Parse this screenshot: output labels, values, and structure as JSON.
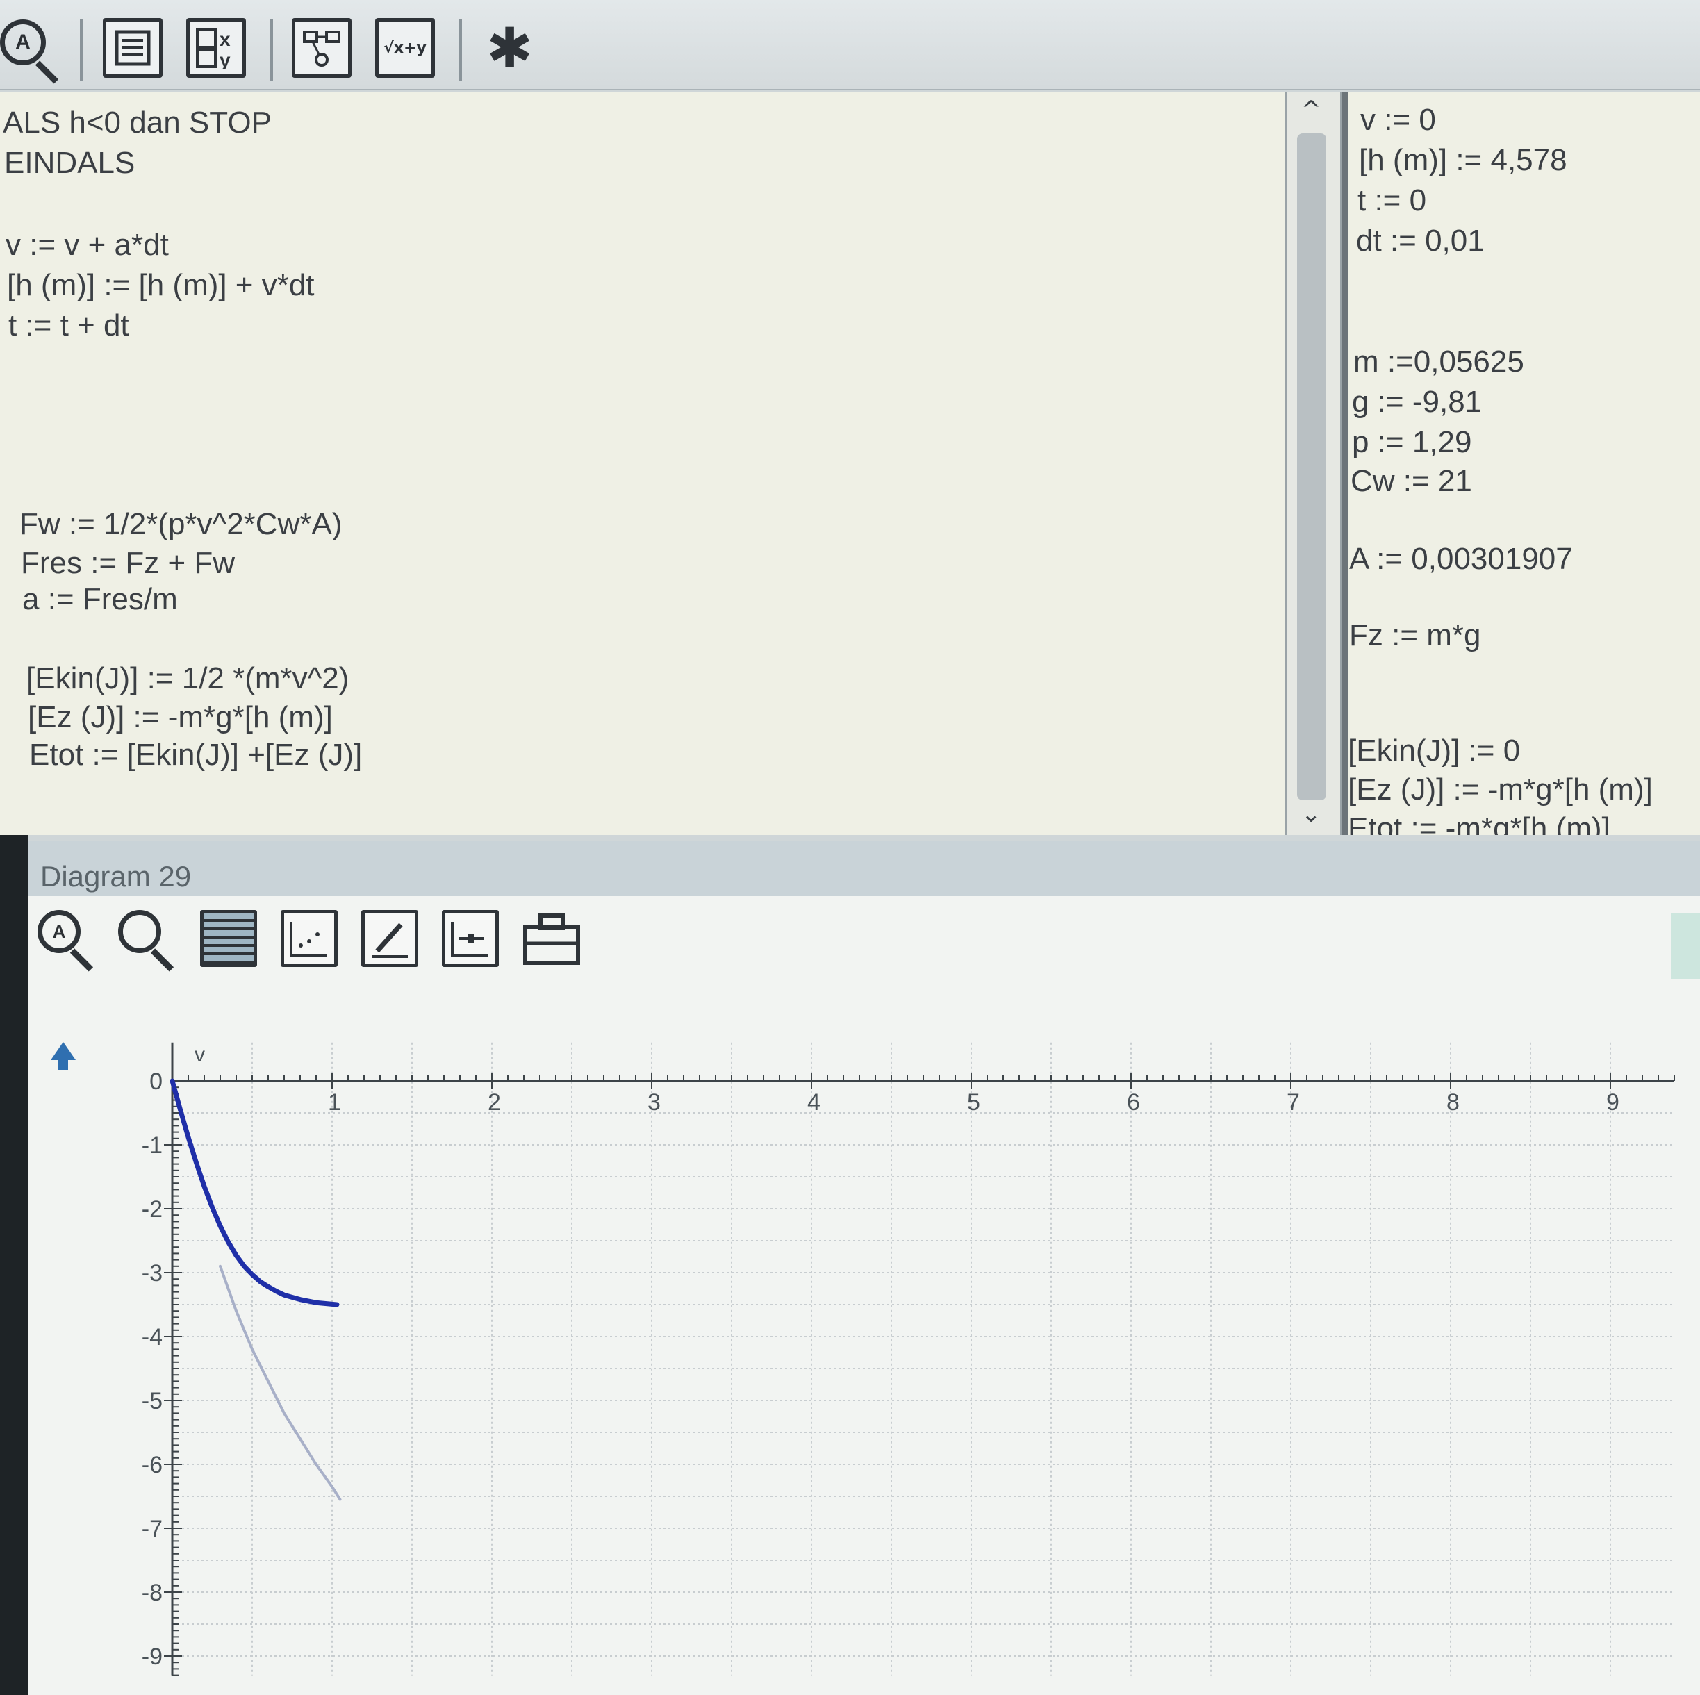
{
  "toolbar": {
    "buttons": [
      {
        "name": "zoom-auto",
        "icon": "magnifier-a-icon",
        "label": "A"
      },
      {
        "name": "text",
        "icon": "document-lines-icon"
      },
      {
        "name": "variables",
        "icon": "variable-table-icon",
        "label": "x y"
      },
      {
        "name": "model",
        "icon": "graph-nodes-icon"
      },
      {
        "name": "formula",
        "icon": "sqrt-formula-icon",
        "label": "√x+y"
      },
      {
        "name": "snippet",
        "icon": "asterisk-icon",
        "label": "✱"
      }
    ]
  },
  "main_editor": {
    "lines": [
      "ALS h<0 dan STOP",
      "EINDALS",
      "v := v + a*dt",
      "[h (m)] := [h (m)] + v*dt",
      "t := t + dt",
      "Fw := 1/2*(p*v^2*Cw*A)",
      "Fres := Fz + Fw",
      "a := Fres/m",
      "[Ekin(J)] := 1/2 *(m*v^2)",
      "[Ez (J)] := -m*g*[h (m)]",
      "Etot := [Ekin(J)] +[Ez (J)]"
    ]
  },
  "side_editor": {
    "lines": [
      "v := 0",
      "[h (m)] := 4,578",
      "t := 0",
      "dt := 0,01",
      "m :=0,05625",
      "g := -9,81",
      "p := 1,29",
      "Cw := 21",
      "A := 0,00301907",
      "Fz := m*g",
      "[Ekin(J)] := 0",
      "[Ez (J)] := -m*g*[h (m)]",
      "Etot := -m*g*[h (m)]"
    ]
  },
  "scrollbar": {
    "up": "^",
    "down": "⌄"
  },
  "diagram": {
    "title": "Diagram 29",
    "tools": [
      "zoom-auto-icon",
      "zoom-icon",
      "grid-icon",
      "scatter-icon",
      "pencil-icon",
      "chart-settings-icon",
      "toolbox-icon"
    ]
  },
  "chart_data": {
    "type": "line",
    "ylabel": "v",
    "xlim": [
      0,
      9.4
    ],
    "ylim": [
      -9.3,
      0.6
    ],
    "x_ticks": [
      "1",
      "2",
      "3",
      "4",
      "5",
      "6",
      "7",
      "8",
      "9"
    ],
    "y_ticks": [
      "0",
      "-1",
      "-2",
      "-3",
      "-4",
      "-5",
      "-6",
      "-7",
      "-8",
      "-9"
    ],
    "grid": true,
    "series": [
      {
        "color": "#1f2fa8",
        "x": [
          0,
          0.05,
          0.1,
          0.15,
          0.2,
          0.25,
          0.3,
          0.35,
          0.4,
          0.45,
          0.5,
          0.55,
          0.6,
          0.65,
          0.7,
          0.8,
          0.9,
          1.03
        ],
        "y": [
          0,
          -0.45,
          -0.88,
          -1.28,
          -1.65,
          -1.98,
          -2.27,
          -2.52,
          -2.73,
          -2.9,
          -3.03,
          -3.14,
          -3.22,
          -3.29,
          -3.35,
          -3.42,
          -3.47,
          -3.5
        ]
      },
      {
        "color": "#a8b0c8",
        "x": [
          0.3,
          0.4,
          0.5,
          0.6,
          0.7,
          0.8,
          0.9,
          1.0,
          1.05
        ],
        "y": [
          -2.9,
          -3.6,
          -4.2,
          -4.7,
          -5.2,
          -5.6,
          -6.0,
          -6.35,
          -6.55
        ]
      }
    ]
  }
}
